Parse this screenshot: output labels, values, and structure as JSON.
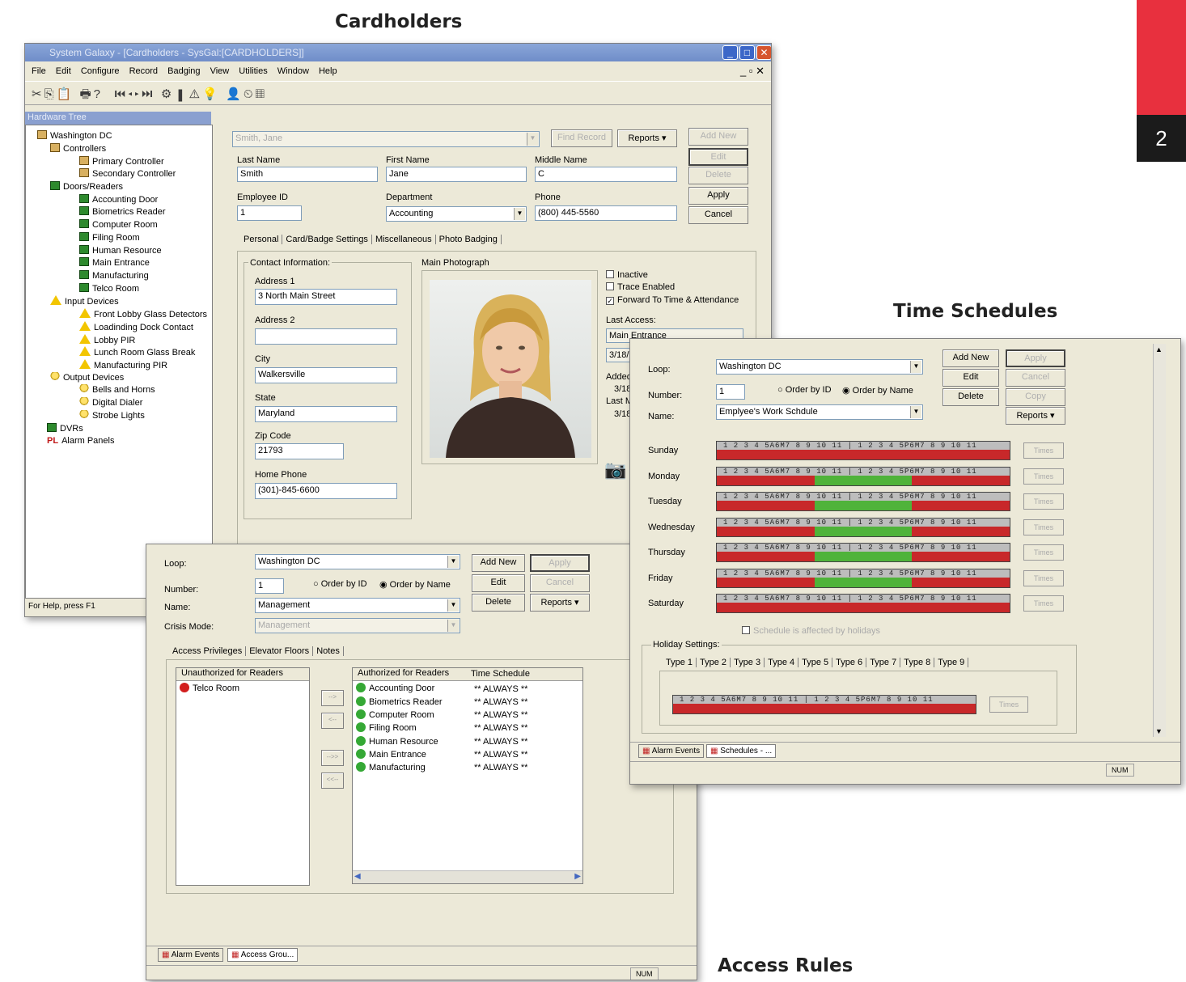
{
  "headings": {
    "cardholders": "Cardholders",
    "time_schedules": "Time Schedules",
    "access_rules": "Access Rules"
  },
  "page_number": "2",
  "cardholders": {
    "title": "System Galaxy - [Cardholders - SysGal:[CARDHOLDERS]]",
    "menu": [
      "File",
      "Edit",
      "Configure",
      "Record",
      "Badging",
      "View",
      "Utilities",
      "Window",
      "Help"
    ],
    "tree_title": "Hardware Tree",
    "tree": [
      "Washington DC",
      "Controllers",
      "Primary Controller",
      "Secondary Controller",
      "Doors/Readers",
      "Accounting Door",
      "Biometrics Reader",
      "Computer Room",
      "Filing Room",
      "Human Resource",
      "Main Entrance",
      "Manufacturing",
      "Telco Room",
      "Input Devices",
      "Front Lobby Glass Detectors",
      "Loadinding Dock Contact",
      "Lobby PIR",
      "Lunch Room Glass Break",
      "Manufacturing PIR",
      "Output Devices",
      "Bells and Horns",
      "Digital Dialer",
      "Strobe Lights",
      "DVRs",
      "Alarm Panels"
    ],
    "status": "For Help, press F1",
    "search": "Smith, Jane",
    "find_record": "Find Record",
    "reports": "Reports",
    "add_new": "Add New",
    "edit": "Edit",
    "delete": "Delete",
    "apply": "Apply",
    "cancel": "Cancel",
    "last_name_label": "Last Name",
    "last_name": "Smith",
    "first_name_label": "First Name",
    "first_name": "Jane",
    "middle_name_label": "Middle Name",
    "middle_name": "C",
    "employee_id_label": "Employee ID",
    "employee_id": "1",
    "department_label": "Department",
    "department": "Accounting",
    "phone_label": "Phone",
    "phone": "(800) 445-5560",
    "tabs": [
      "Personal",
      "Card/Badge Settings",
      "Miscellaneous",
      "Photo Badging"
    ],
    "contact_info": "Contact Information:",
    "address1_label": "Address 1",
    "address1": "3 North Main Street",
    "address2_label": "Address 2",
    "address2": "",
    "city_label": "City",
    "city": "Walkersville",
    "state_label": "State",
    "state": "Maryland",
    "zip_label": "Zip Code",
    "zip": "21793",
    "home_phone_label": "Home Phone",
    "home_phone": "(301)-845-6600",
    "main_photo": "Main Photograph",
    "inactive": "Inactive",
    "trace_enabled": "Trace Enabled",
    "forward": "Forward To Time & Attendance",
    "last_access_label": "Last Access:",
    "last_access": "Main Entrance",
    "last_access_date": "3/18/",
    "added_label": "Added",
    "added_val": "3/18",
    "last_m_label": "Last M",
    "last_m_val": "3/18"
  },
  "access_rules": {
    "loop_label": "Loop:",
    "loop": "Washington DC",
    "number_label": "Number:",
    "number": "1",
    "order_by_id": "Order by ID",
    "order_by_name": "Order by Name",
    "name_label": "Name:",
    "name": "Management",
    "crisis_label": "Crisis Mode:",
    "crisis": "Management",
    "add_new": "Add New",
    "apply": "Apply",
    "edit": "Edit",
    "cancel": "Cancel",
    "delete": "Delete",
    "reports": "Reports",
    "tabs": [
      "Access Privileges",
      "Elevator Floors",
      "Notes"
    ],
    "unauth_header": "Unauthorized for Readers",
    "unauth": [
      "Telco Room"
    ],
    "auth_header": "Authorized for Readers",
    "time_header": "Time Schedule",
    "auth": [
      "Accounting Door",
      "Biometrics Reader",
      "Computer Room",
      "Filing Room",
      "Human Resource",
      "Main Entrance",
      "Manufacturing"
    ],
    "always": "** ALWAYS **",
    "move_buttons": [
      "-->",
      "<--",
      "-->>",
      "<<--"
    ],
    "taskbar": [
      "Alarm Events",
      "Access Grou..."
    ],
    "num": "NUM"
  },
  "time_schedules": {
    "loop_label": "Loop:",
    "loop": "Washington DC",
    "number_label": "Number:",
    "number": "1",
    "order_by_id": "Order by ID",
    "order_by_name": "Order by Name",
    "name_label": "Name:",
    "name": "Emplyee's Work Schdule",
    "add_new": "Add New",
    "apply": "Apply",
    "edit": "Edit",
    "cancel": "Cancel",
    "delete": "Delete",
    "copy": "Copy",
    "reports": "Reports",
    "hour_labels": "1  2  3  4  5A6M7  8  9 10 11 |  1  2  3  4  5P6M7  8  9 10 11",
    "days": [
      "Sunday",
      "Monday",
      "Tuesday",
      "Wednesday",
      "Thursday",
      "Friday",
      "Saturday"
    ],
    "active": [
      0,
      1,
      1,
      1,
      1,
      1,
      0
    ],
    "times_btn": "Times",
    "holiday_check": "Schedule is affected by holidays",
    "holiday_label": "Holiday Settings:",
    "holiday_tabs": [
      "Type 1",
      "Type 2",
      "Type 3",
      "Type 4",
      "Type 5",
      "Type 6",
      "Type 7",
      "Type 8",
      "Type 9"
    ],
    "taskbar": [
      "Alarm Events",
      "Schedules - ..."
    ],
    "num": "NUM",
    "colors": {
      "on": "#4fb33a",
      "off": "#c8282a"
    }
  }
}
